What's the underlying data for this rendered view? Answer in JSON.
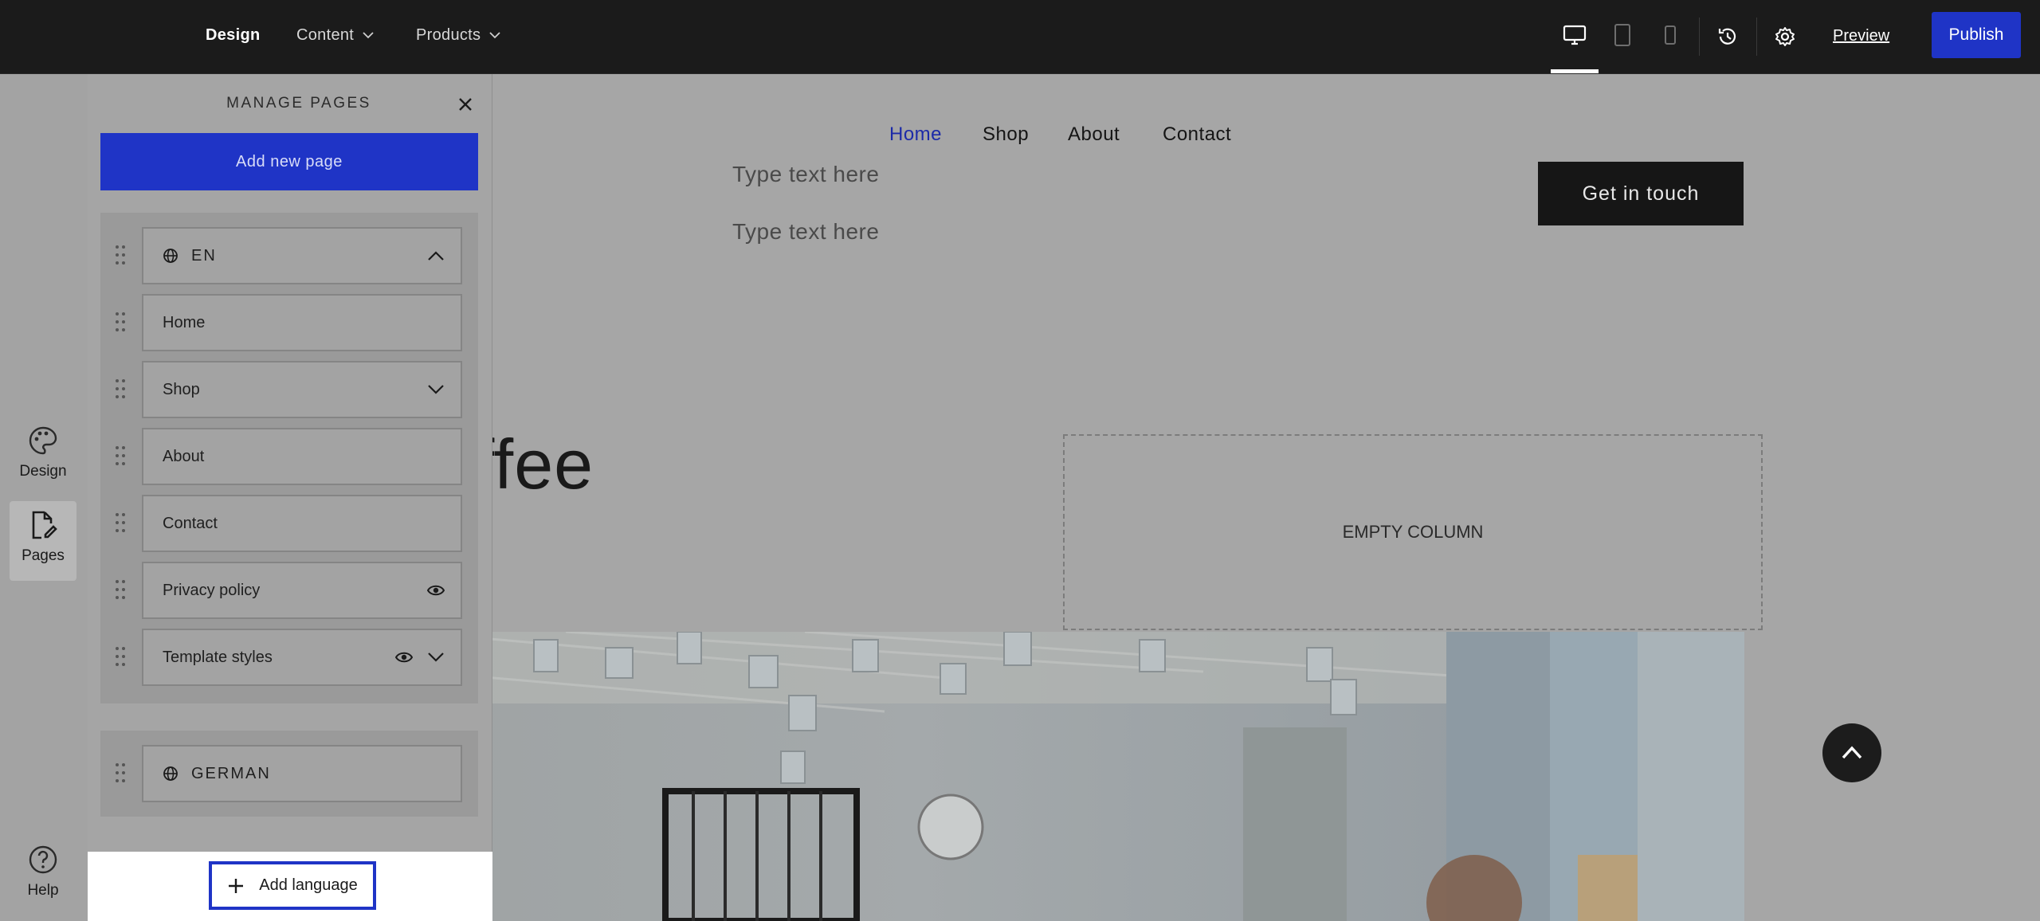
{
  "topbar": {
    "nav": {
      "design": "Design",
      "content": "Content",
      "products": "Products"
    },
    "preview": "Preview",
    "publish": "Publish"
  },
  "rail": {
    "design": "Design",
    "pages": "Pages",
    "help": "Help"
  },
  "site": {
    "nav": {
      "home": "Home",
      "shop": "Shop",
      "about": "About",
      "contact": "Contact"
    },
    "type_text_1": "Type text here",
    "type_text_2": "Type text here",
    "cta": "Get in touch",
    "hero_heading": "op our coffee\nb",
    "empty_column": "EMPTY COLUMN"
  },
  "panel": {
    "title": "MANAGE PAGES",
    "add_page": "Add new page",
    "languages": [
      {
        "code": "EN",
        "pages": [
          {
            "label": "Home"
          },
          {
            "label": "Shop"
          },
          {
            "label": "About"
          },
          {
            "label": "Contact"
          },
          {
            "label": "Privacy policy"
          },
          {
            "label": "Template styles"
          }
        ]
      },
      {
        "code": "GERMAN"
      }
    ],
    "add_language": "Add language"
  },
  "colors": {
    "accent": "#1f34c6",
    "topbar": "#1b1b1b",
    "active_nav": "#1c2aa8"
  }
}
